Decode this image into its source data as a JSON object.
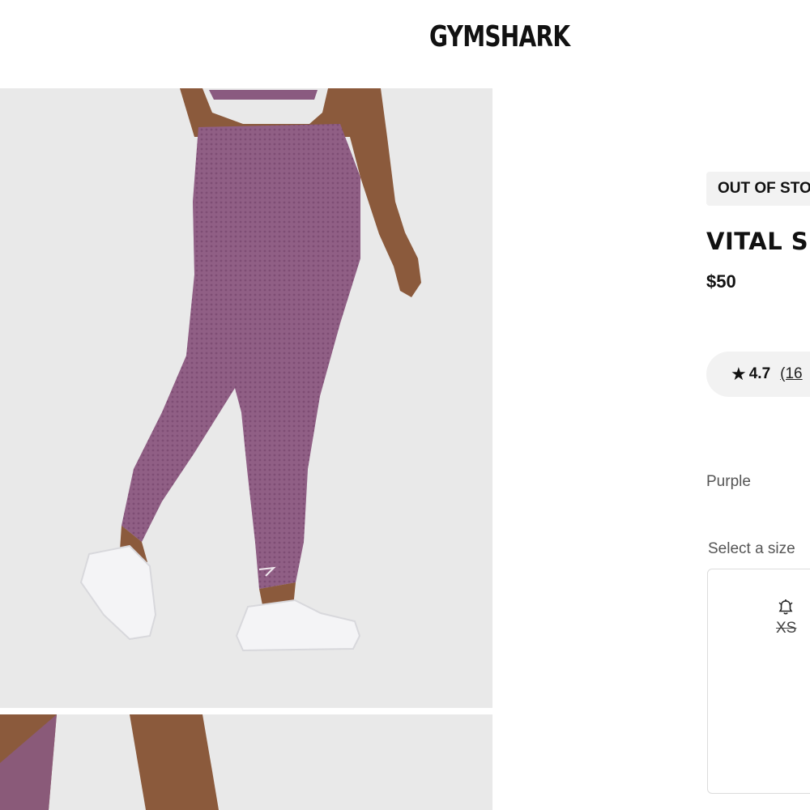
{
  "header": {
    "brand": "GYMSHARK"
  },
  "gallery": {
    "main_image_alt": "Model wearing purple seamless leggings and white running shoes",
    "second_image_alt": "Close-up of purple leggings"
  },
  "product": {
    "stock_badge": "OUT OF STOCK",
    "title": "VITAL SEAMLESS LEGGINGS",
    "price": "$50",
    "rating": {
      "star_icon": "★",
      "score": "4.7",
      "count": "(16"
    },
    "colour": "Purple",
    "size_label": "Select a size",
    "sizes": [
      {
        "label": "XS",
        "available": false,
        "icon": "bell-icon"
      }
    ]
  },
  "colors": {
    "legging_purple": "#8d5a80",
    "image_bg": "#e9e9e9",
    "pill_bg": "#f2f2f2"
  }
}
